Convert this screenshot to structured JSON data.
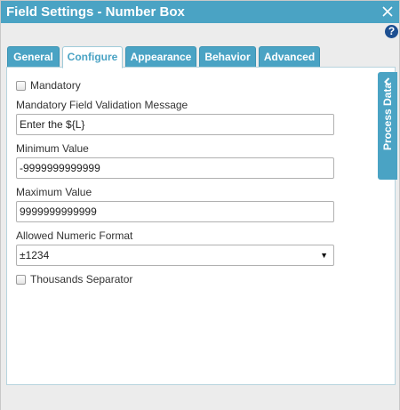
{
  "window": {
    "title": "Field Settings - Number Box"
  },
  "icons": {
    "close": "close-icon",
    "help": "help-icon",
    "collapse": "chevron-left-icon"
  },
  "tabs": [
    {
      "label": "General"
    },
    {
      "label": "Configure",
      "active": true
    },
    {
      "label": "Appearance"
    },
    {
      "label": "Behavior"
    },
    {
      "label": "Advanced"
    }
  ],
  "form": {
    "mandatory_label": "Mandatory",
    "mandatory_checked": false,
    "validation_label": "Mandatory Field Validation Message",
    "validation_value": "Enter the ${L}",
    "min_label": "Minimum Value",
    "min_value": "-9999999999999",
    "max_label": "Maximum Value",
    "max_value": "9999999999999",
    "format_label": "Allowed Numeric Format",
    "format_value": "±1234",
    "thousands_label": "Thousands Separator",
    "thousands_checked": false
  },
  "side_panel": {
    "label": "Process Data"
  },
  "colors": {
    "accent": "#4aa3c4",
    "help": "#1d4f91"
  }
}
